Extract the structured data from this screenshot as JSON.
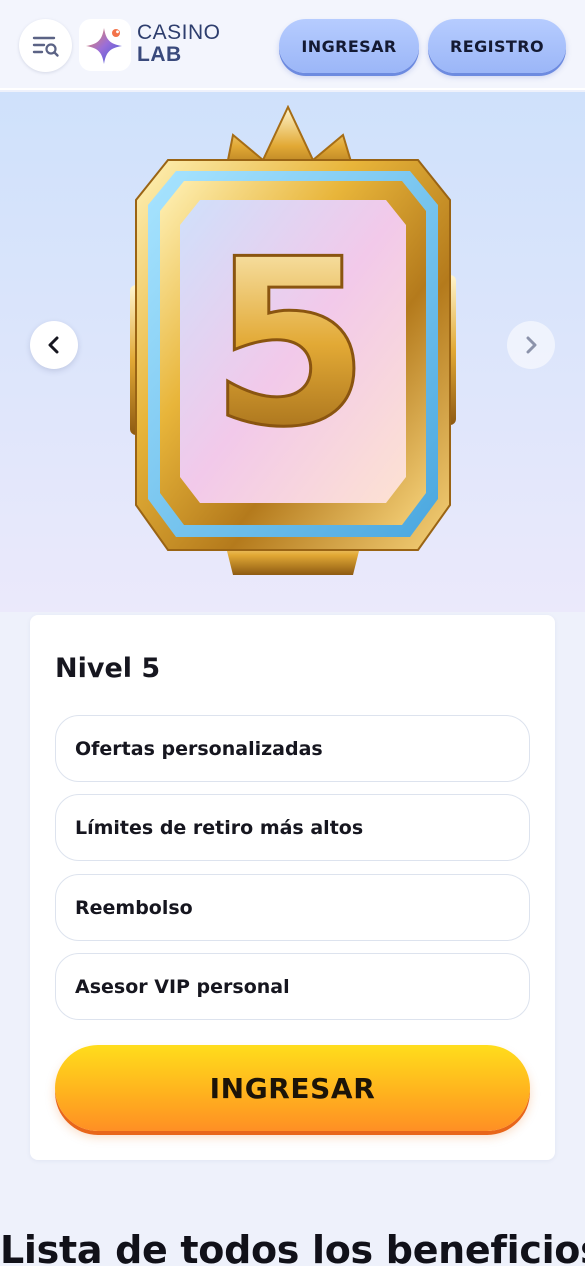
{
  "header": {
    "logo_line1": "CASINO",
    "logo_line2": "LAB",
    "login_label": "INGRESAR",
    "register_label": "REGISTRO",
    "menu_icon": "menu-search-icon",
    "logo_icon": "sparkle-star-icon"
  },
  "hero": {
    "badge_number": "5",
    "prev_icon": "chevron-left-icon",
    "next_icon": "chevron-right-icon"
  },
  "level_card": {
    "title": "Nivel 5",
    "benefits": [
      "Ofertas personalizadas",
      "Límites de retiro más altos",
      "Reembolso",
      "Asesor VIP personal"
    ],
    "cta_label": "INGRESAR"
  },
  "section": {
    "title": "Lista de todos los beneficios"
  },
  "colors": {
    "accent_blue": "#9bb6f7",
    "cta_yellow": "#ffdd1c",
    "cta_orange": "#ff8f24",
    "badge_gold": "#e8b53a"
  }
}
